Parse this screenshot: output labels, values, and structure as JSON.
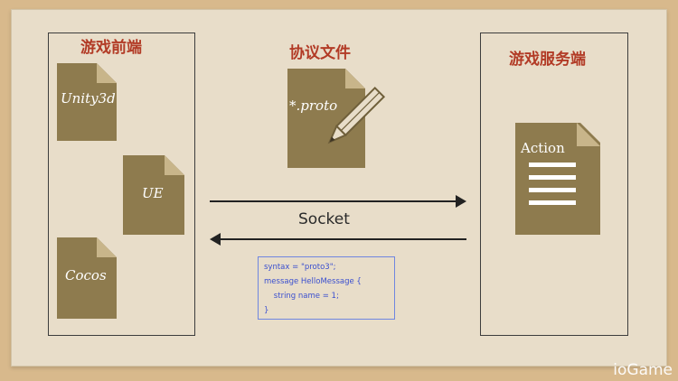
{
  "client": {
    "title": "游戏前端",
    "docs": [
      {
        "label": "Unity3d"
      },
      {
        "label": "UE"
      },
      {
        "label": "Cocos"
      }
    ]
  },
  "protocol": {
    "title": "协议文件",
    "doc_label": "*.proto"
  },
  "server": {
    "title": "游戏服务端",
    "doc_label": "Action"
  },
  "connection": {
    "label": "Socket"
  },
  "code": {
    "lines": [
      "syntax = \"proto3\";",
      "message HelloMessage {",
      "    string name = 1;",
      "}"
    ]
  },
  "watermark": "ioGame",
  "colors": {
    "title": "#b23b26",
    "doc": "#8e7b4e",
    "code": "#3a4fcf"
  }
}
